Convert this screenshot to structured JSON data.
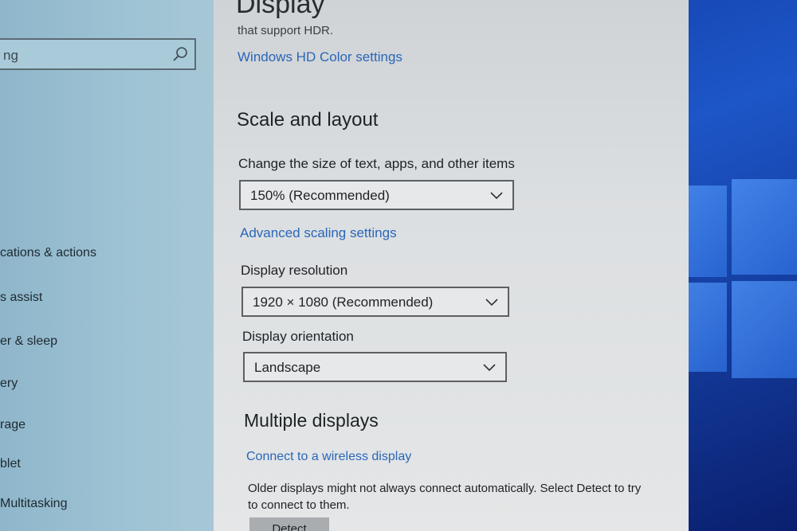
{
  "sidebar": {
    "search_placeholder": "ng",
    "items": [
      {
        "label": "cations & actions"
      },
      {
        "label": "s assist"
      },
      {
        "label": "er & sleep"
      },
      {
        "label": "ery"
      },
      {
        "label": "rage"
      },
      {
        "label": "blet"
      },
      {
        "label": "Multitasking"
      }
    ]
  },
  "main": {
    "title": "Display",
    "hdr_note": "that support HDR.",
    "hdr_link": "Windows HD Color settings",
    "scale_section": {
      "title": "Scale and layout",
      "size_label": "Change the size of text, apps, and other items",
      "size_value": "150% (Recommended)",
      "advanced_link": "Advanced scaling settings",
      "resolution_label": "Display resolution",
      "resolution_value": "1920 × 1080 (Recommended)",
      "orientation_label": "Display orientation",
      "orientation_value": "Landscape"
    },
    "multi_section": {
      "title": "Multiple displays",
      "wireless_link": "Connect to a wireless display",
      "note": "Older displays might not always connect automatically. Select Detect to try to connect to them.",
      "detect_label": "Detect"
    }
  },
  "icons": {
    "search": "search-icon",
    "chevron": "chevron-down-icon",
    "windows_logo": "windows-logo-icon"
  },
  "colors": {
    "link": "#2a66b8",
    "desktop_bg": "#1d56c8",
    "sidebar_bg": "#9ec3d4",
    "panel_bg": "#dcdfe1"
  }
}
